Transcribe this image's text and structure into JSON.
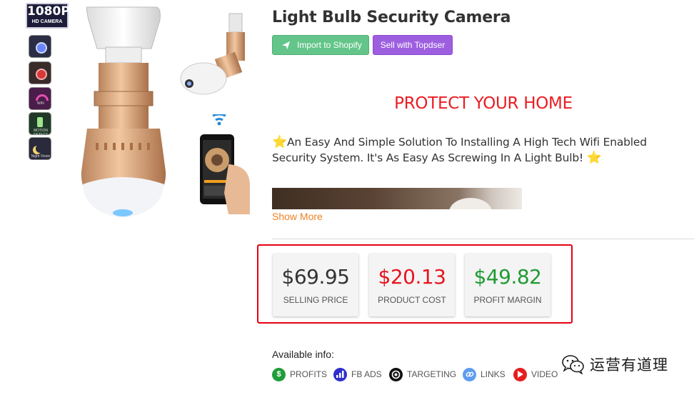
{
  "product": {
    "title": "Light Bulb Security Camera",
    "image": {
      "badge_main": "1080P",
      "badge_sub": "HD CAMERA",
      "feature_icons": [
        "camera-icon",
        "record-icon",
        "wifi-icon",
        "motion-detect-icon",
        "night-vision-icon"
      ],
      "feature_captions": [
        "WiFi",
        "MOTION DETECT",
        "Night Vision"
      ]
    }
  },
  "actions": {
    "import_label": "Import to Shopify",
    "topdser_label": "Sell with Topdser"
  },
  "description": {
    "heading": "PROTECT YOUR HOME",
    "star": "⭐",
    "body": "An Easy And Simple Solution To Installing A High Tech Wifi Enabled Security System. It's As Easy As Screwing In A Light Bulb!",
    "show_more": "Show More"
  },
  "stats": [
    {
      "value": "$69.95",
      "label": "SELLING PRICE",
      "color": "#333333"
    },
    {
      "value": "$20.13",
      "label": "PRODUCT COST",
      "color": "#e7141e"
    },
    {
      "value": "$49.82",
      "label": "PROFIT MARGIN",
      "color": "#1f9b32"
    }
  ],
  "available_info": {
    "label": "Available info:",
    "items": [
      {
        "label": "PROFITS",
        "icon": "dollar-icon",
        "glyph": "$"
      },
      {
        "label": "FB ADS",
        "icon": "bar-chart-icon",
        "glyph": ""
      },
      {
        "label": "TARGETING",
        "icon": "target-icon",
        "glyph": ""
      },
      {
        "label": "LINKS",
        "icon": "link-icon",
        "glyph": ""
      },
      {
        "label": "VIDEO",
        "icon": "play-icon",
        "glyph": ""
      }
    ]
  },
  "watermark": {
    "text": "运营有道理",
    "icon": "wechat-icon"
  }
}
